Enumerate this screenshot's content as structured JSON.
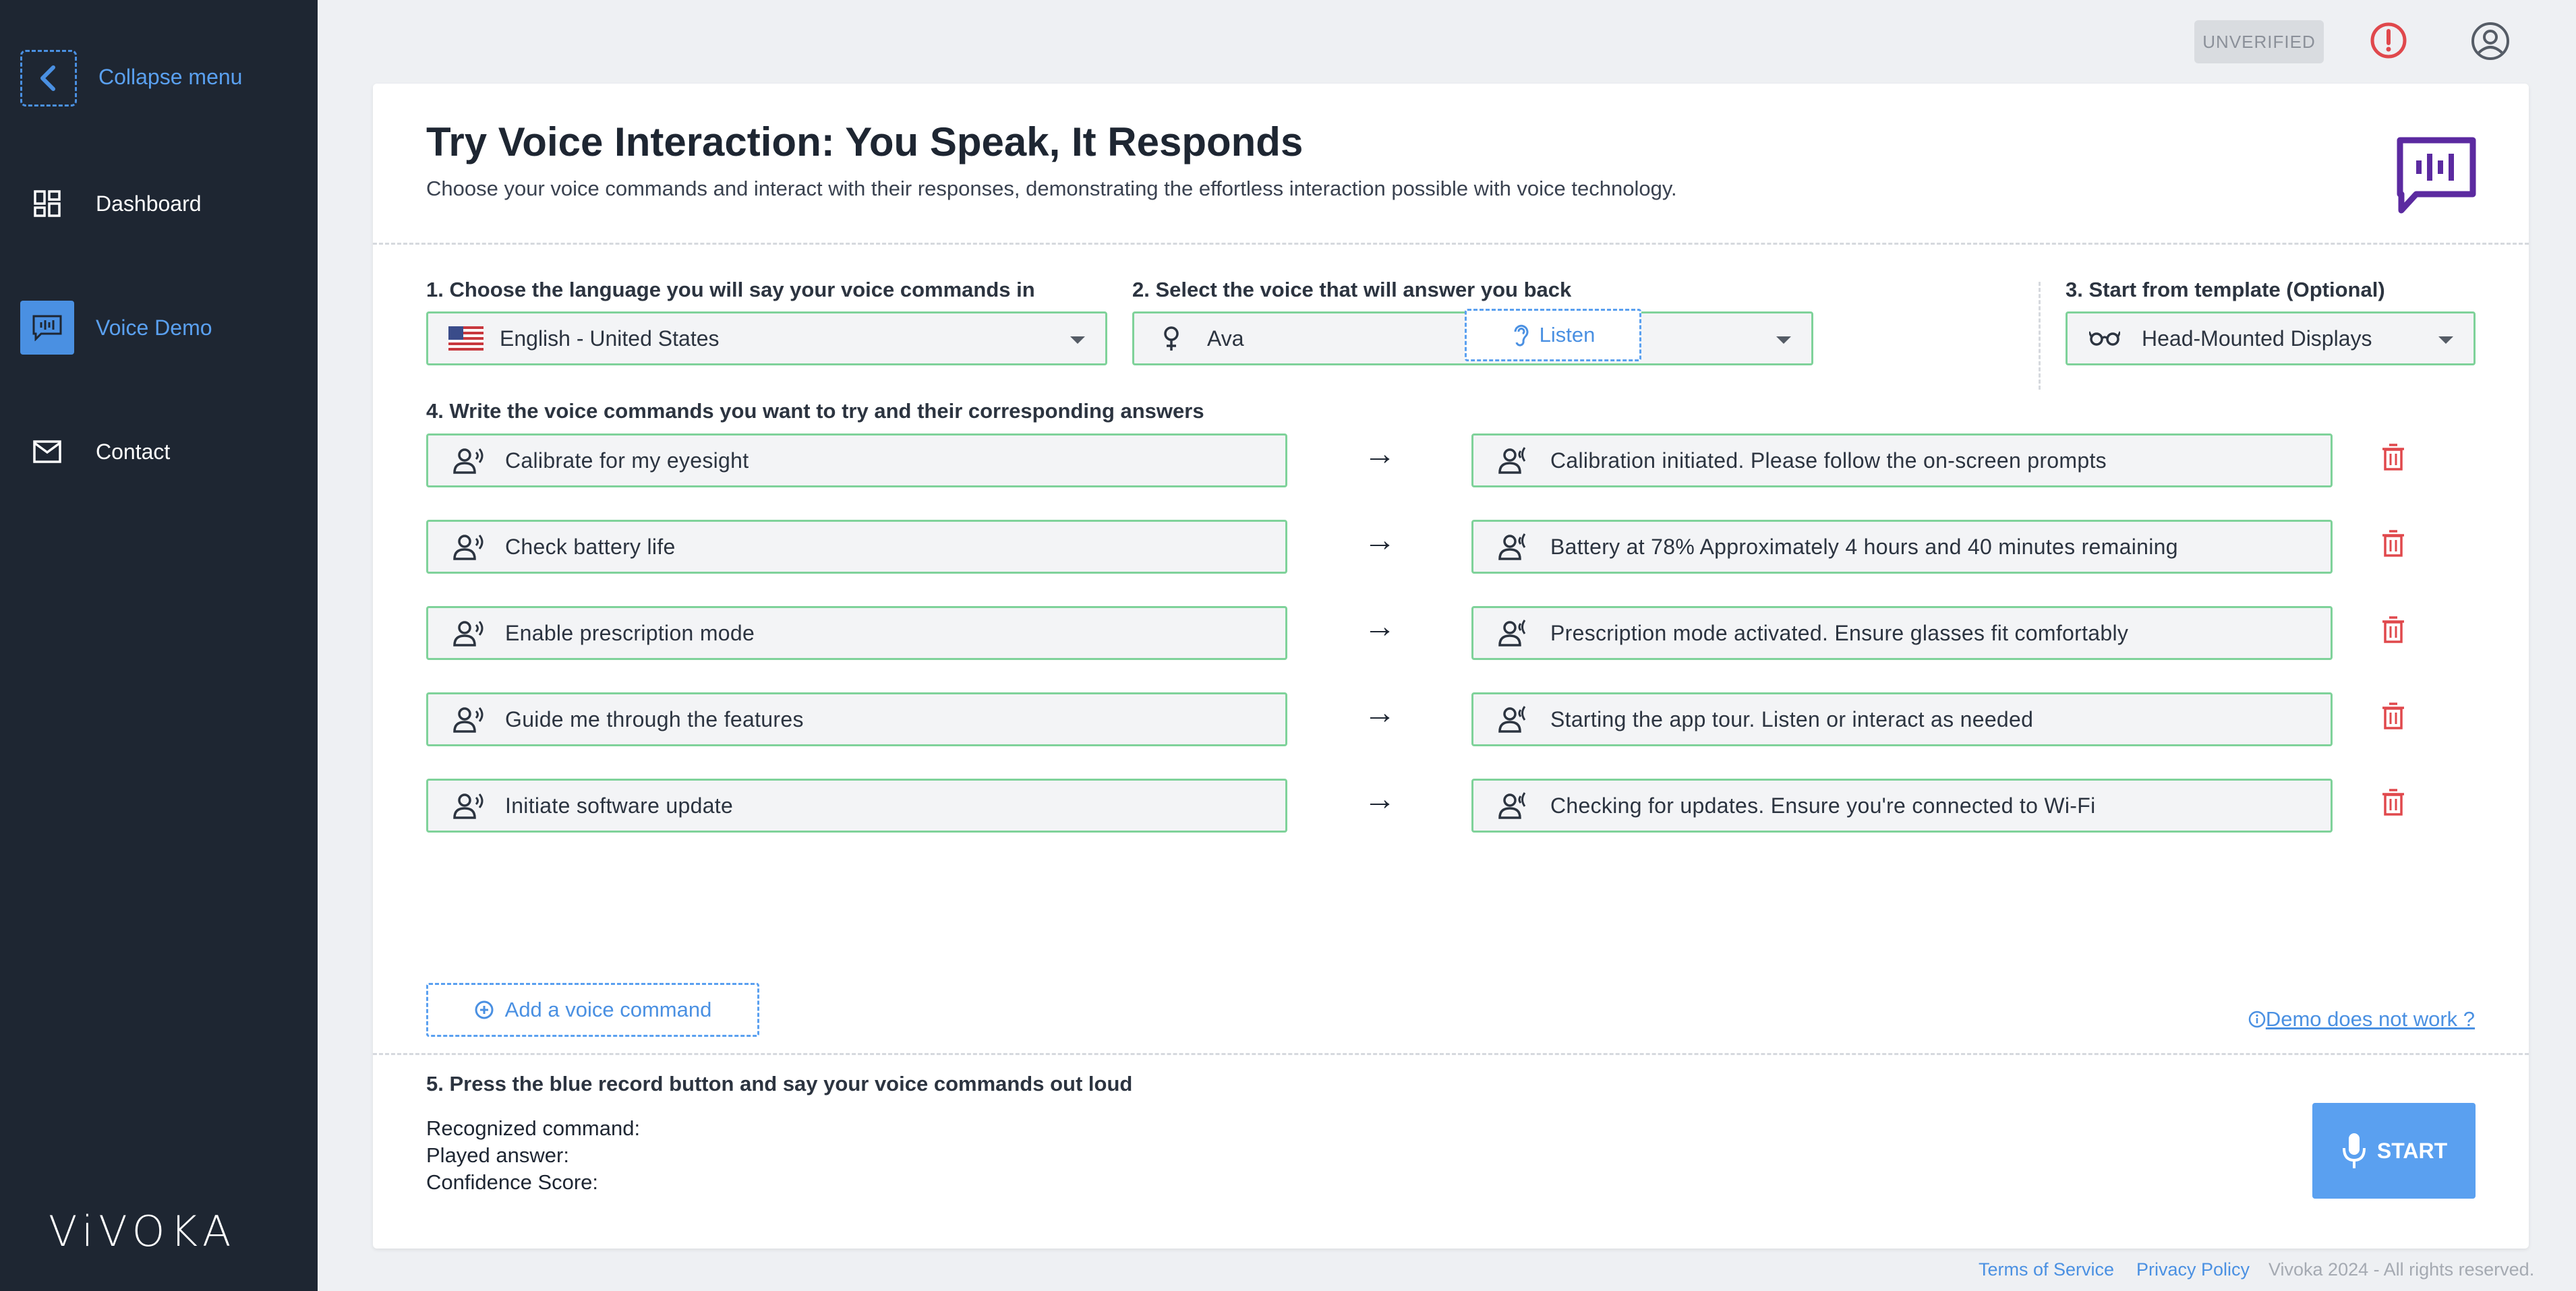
{
  "sidebar": {
    "collapse_label": "Collapse menu",
    "items": [
      {
        "label": "Dashboard",
        "icon": "dashboard-icon",
        "active": false
      },
      {
        "label": "Voice Demo",
        "icon": "voice-demo-icon",
        "active": true
      },
      {
        "label": "Contact",
        "icon": "mail-icon",
        "active": false
      }
    ],
    "logo_text": "ViVOKA"
  },
  "topbar": {
    "badge": "UNVERIFIED"
  },
  "header": {
    "title": "Try Voice Interaction: You Speak, It Responds",
    "subtitle": "Choose your voice commands and interact with their responses, demonstrating the effortless interaction possible with voice technology."
  },
  "step1": {
    "label": "1. Choose the language you will say your voice commands in",
    "value": "English - United States"
  },
  "step2": {
    "label": "2. Select the voice that will answer you back",
    "value": "Ava",
    "listen_label": "Listen"
  },
  "step3": {
    "label": "3. Start from template (Optional)",
    "value": "Head-Mounted Displays"
  },
  "step4": {
    "label": "4. Write the voice commands you want to try and their corresponding answers",
    "commands": [
      {
        "command": "Calibrate for my eyesight",
        "answer": "Calibration initiated. Please follow the on-screen prompts"
      },
      {
        "command": "Check battery life",
        "answer": "Battery at 78% Approximately 4 hours and 40 minutes remaining"
      },
      {
        "command": "Enable prescription mode",
        "answer": "Prescription mode activated. Ensure glasses fit comfortably"
      },
      {
        "command": "Guide me through the features",
        "answer": "Starting the app tour. Listen or interact as needed"
      },
      {
        "command": "Initiate software update",
        "answer": "Checking for updates. Ensure you're connected to Wi-Fi"
      }
    ],
    "add_label": "Add a voice command",
    "demo_link": "Demo does not work ?"
  },
  "step5": {
    "label": "5. Press the blue record button and say your voice commands out loud",
    "recognized_label": "Recognized command:",
    "played_label": "Played answer:",
    "confidence_label": "Confidence Score:",
    "start_label": "START"
  },
  "footer": {
    "terms": "Terms of Service",
    "privacy": "Privacy Policy",
    "copyright": "Vivoka 2024 - All rights reserved."
  },
  "colors": {
    "sidebar_bg": "#1e2632",
    "accent": "#4a90e2",
    "field_border": "#7fd29a",
    "danger": "#e0484c",
    "brand_purple": "#5b2aa0"
  }
}
